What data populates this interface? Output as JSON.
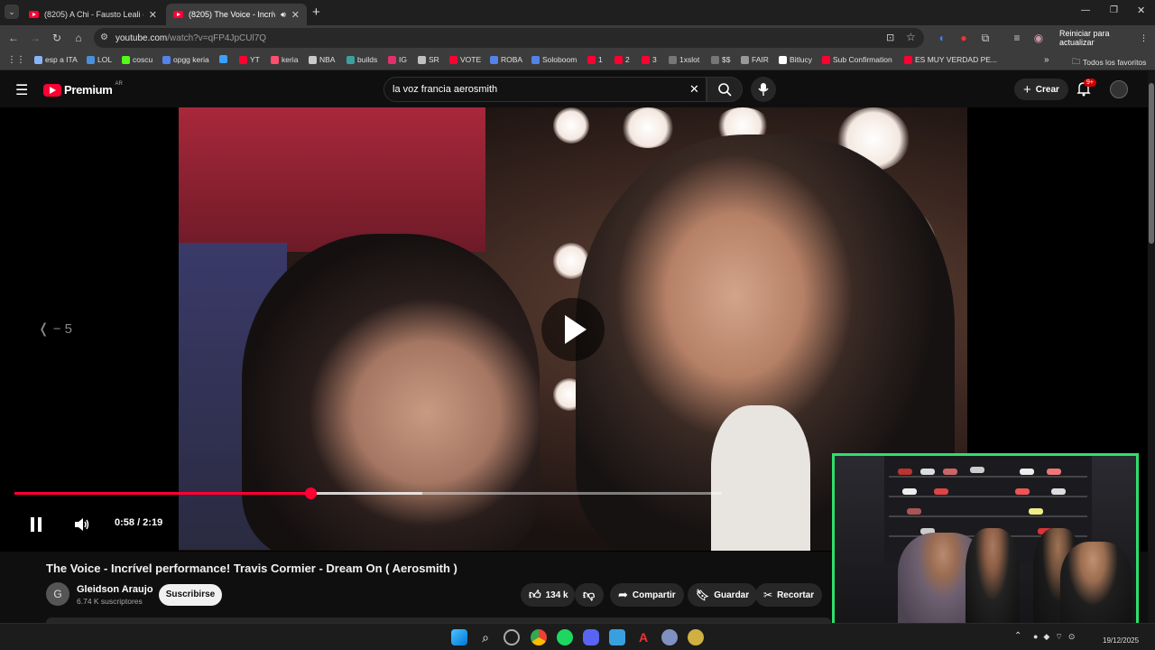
{
  "tabs": [
    {
      "label": "(8205) A Chi - Fausto Leali - Yo"
    },
    {
      "label": "(8205) The Voice - Incrível p"
    }
  ],
  "address": {
    "host": "youtube.com",
    "path": "/watch?v=qFP4JpCUl7Q"
  },
  "toolbar": {
    "restart_label": "Reiniciar para actualizar"
  },
  "bookmarks": [
    {
      "label": "esp a ITA",
      "color": "#8ab4f8"
    },
    {
      "label": "LOL",
      "color": "#4a90d9"
    },
    {
      "label": "coscu",
      "color": "#53fc18"
    },
    {
      "label": "opgg keria",
      "color": "#5383e8"
    },
    {
      "label": "",
      "color": "#3aa0ff"
    },
    {
      "label": "YT",
      "color": "#ff0033"
    },
    {
      "label": "keria",
      "color": "#ff4e6e"
    },
    {
      "label": "NBA",
      "color": "#c9c9c9"
    },
    {
      "label": "builds",
      "color": "#3ca0a0"
    },
    {
      "label": "IG",
      "color": "#e1306c"
    },
    {
      "label": "SR",
      "color": "#c0c0c0"
    },
    {
      "label": "VOTE",
      "color": "#ff0033"
    },
    {
      "label": "ROBA",
      "color": "#5383e8"
    },
    {
      "label": "Soloboom",
      "color": "#5383e8"
    },
    {
      "label": "1",
      "color": "#ff0033"
    },
    {
      "label": "2",
      "color": "#ff0033"
    },
    {
      "label": "3",
      "color": "#ff0033"
    },
    {
      "label": "1xslot",
      "color": "#777777"
    },
    {
      "label": "$$",
      "color": "#777777"
    },
    {
      "label": "FAIR",
      "color": "#999999"
    },
    {
      "label": "Bitlucy",
      "color": "#ffffff"
    },
    {
      "label": "Sub Confirmation",
      "color": "#ff0033"
    },
    {
      "label": "ES MUY VERDAD PE...",
      "color": "#ff0033"
    }
  ],
  "bookmarks_all": "Todos los favoritos",
  "yt": {
    "brand": "Premium",
    "country": "AR",
    "search_query": "la voz francia aerosmith",
    "create_label": "Crear",
    "notifications_badge": "9+"
  },
  "player": {
    "seek_label": "❬ − 5",
    "time": "0:58 / 2:19",
    "progress": 0.418,
    "buffered": 0.576
  },
  "video": {
    "title": "The Voice - Incrível performance! Travis Cormier - Dream On ( Aerosmith )",
    "channel": "Gleidson Araujo",
    "channel_initial": "G",
    "subscribers": "6.74 K suscriptores",
    "subscribe_label": "Suscribirse",
    "likes": "134 k",
    "share_label": "Compartir",
    "save_label": "Guardar",
    "clip_label": "Recortar"
  },
  "taskbar": {
    "date": "19/12/2025"
  },
  "colors": {
    "accent": "#ff0033",
    "webcam_border": "#2ee06b"
  }
}
